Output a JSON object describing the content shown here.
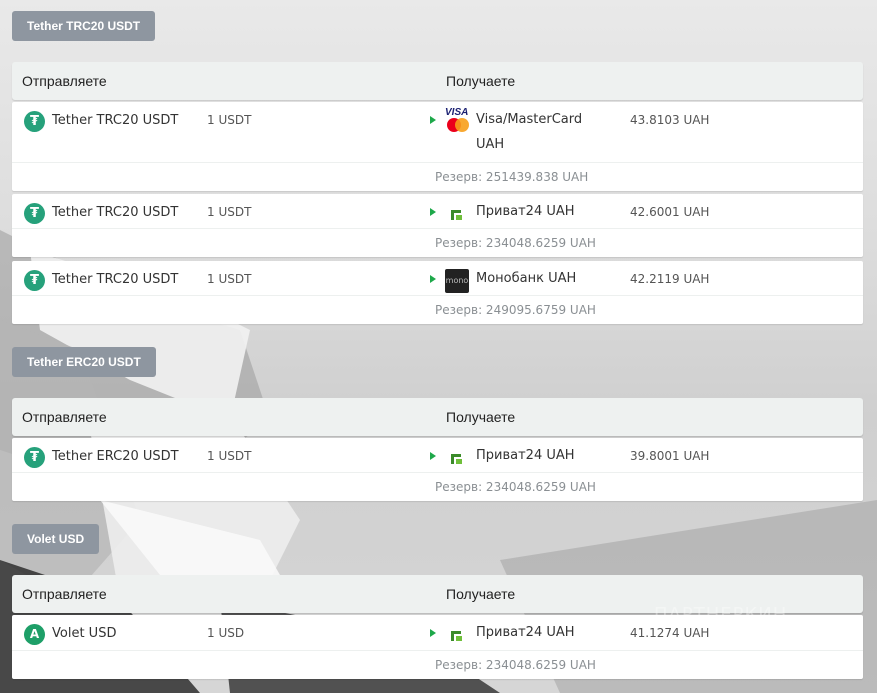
{
  "sections": [
    {
      "tab": "Tether TRC20 USDT",
      "head_send": "Отправляете",
      "head_recv": "Получаете",
      "rows": [
        {
          "send_name": "Tether TRC20 USDT",
          "send_amount": "1 USDT",
          "recv_name_1": "Visa/MasterCard",
          "recv_name_2": "UAH",
          "recv_amount": "43.8103 UAH",
          "reserve": "Резерв: 251439.838 UAH"
        },
        {
          "send_name": "Tether TRC20 USDT",
          "send_amount": "1 USDT",
          "recv_name_1": "Приват24 UAH",
          "recv_amount": "42.6001 UAH",
          "reserve": "Резерв: 234048.6259 UAH"
        },
        {
          "send_name": "Tether TRC20 USDT",
          "send_amount": "1 USDT",
          "recv_name_1": "Монобанк UAH",
          "recv_amount": "42.2119 UAH",
          "reserve": "Резерв: 249095.6759 UAH"
        }
      ]
    },
    {
      "tab": "Tether ERC20 USDT",
      "head_send": "Отправляете",
      "head_recv": "Получаете",
      "rows": [
        {
          "send_name": "Tether ERC20 USDT",
          "send_amount": "1 USDT",
          "recv_name_1": "Приват24 UAH",
          "recv_amount": "39.8001 UAH",
          "reserve": "Резерв: 234048.6259 UAH"
        }
      ]
    },
    {
      "tab": "Volet USD",
      "head_send": "Отправляете",
      "head_recv": "Получаете",
      "rows": [
        {
          "send_name": "Volet USD",
          "send_amount": "1 USD",
          "recv_name_1": "Приват24 UAH",
          "recv_amount": "41.1274 UAH",
          "reserve": "Резерв: 234048.6259 UAH"
        }
      ]
    }
  ],
  "icons": {
    "tether": "tether-icon",
    "volet": "volet-icon",
    "visa_mastercard": "visa-mastercard-icon",
    "privat24": "privat24-icon",
    "monobank": "monobank-icon",
    "mono_label": "mono",
    "visa_label": "VISA"
  },
  "colors": {
    "tab_bg": "#8e96a0",
    "tether_green": "#26a17b",
    "arrow_green": "#1ea84a"
  },
  "watermark": "ПАРТНЕРКИН"
}
